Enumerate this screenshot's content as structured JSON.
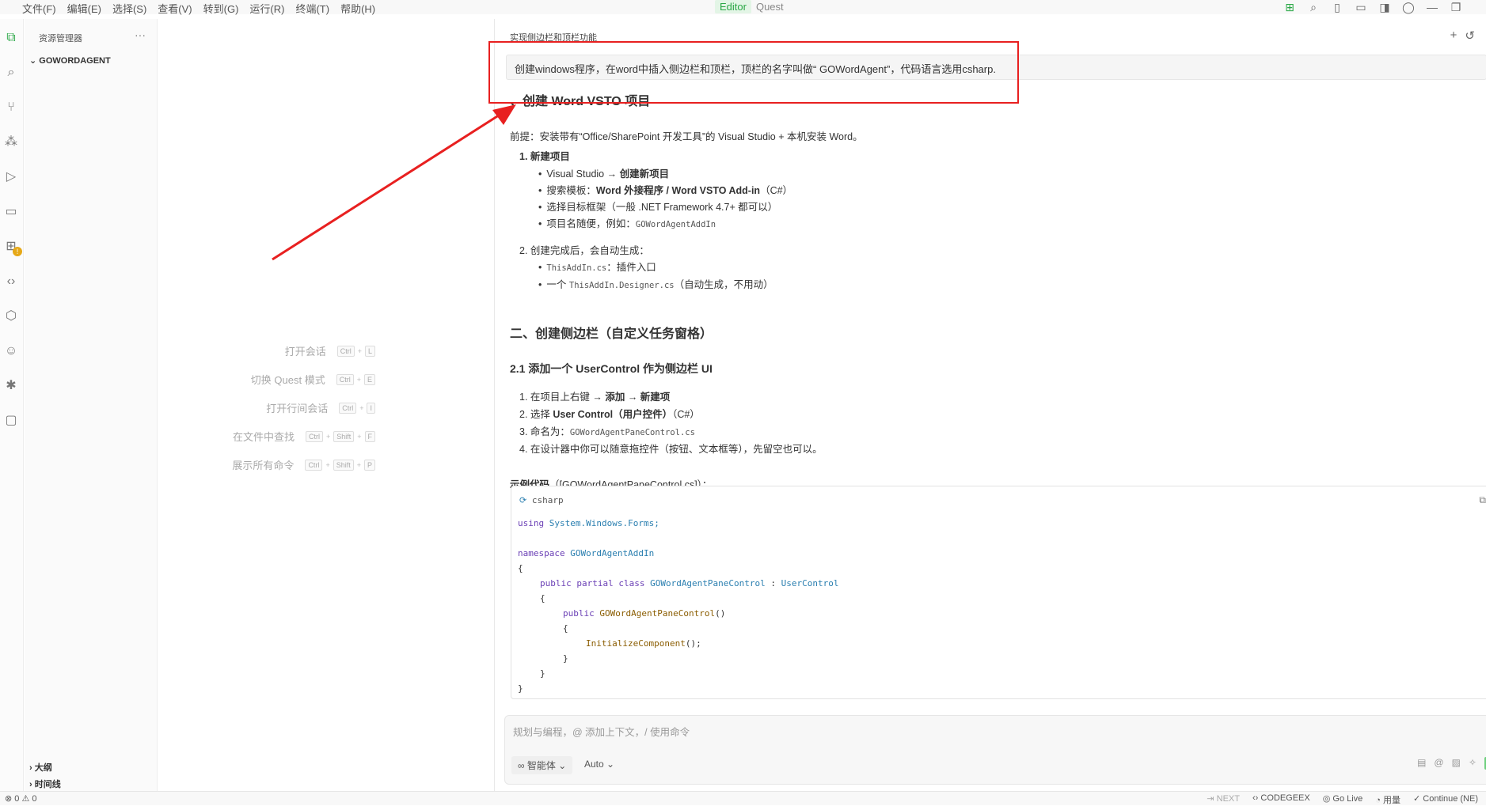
{
  "menubar": {
    "items": [
      "文件(F)",
      "编辑(E)",
      "选择(S)",
      "查看(V)",
      "转到(G)",
      "运行(R)",
      "终端(T)",
      "帮助(H)"
    ],
    "modes": {
      "editor": "Editor",
      "quest": "Quest"
    }
  },
  "explorer": {
    "title": "资源管理器",
    "more": "···",
    "root": "GOWORDAGENT",
    "outline": "大纲",
    "timeline": "时间线"
  },
  "welcome": {
    "shortcuts": [
      {
        "label": "打开会话",
        "keys": [
          "Ctrl",
          "L"
        ]
      },
      {
        "label": "切换 Quest 模式",
        "keys": [
          "Ctrl",
          "E"
        ]
      },
      {
        "label": "打开行间会话",
        "keys": [
          "Ctrl",
          "I"
        ]
      },
      {
        "label": "在文件中查找",
        "keys": [
          "Ctrl",
          "Shift",
          "F"
        ]
      },
      {
        "label": "展示所有命令",
        "keys": [
          "Ctrl",
          "Shift",
          "P"
        ]
      }
    ]
  },
  "chat": {
    "title": "实现侧边栏和顶栏功能",
    "user_message": "创建windows程序，在word中插入侧边栏和顶栏，顶栏的名字叫做“ GOWordAgent”，代码语言选用csharp.",
    "heading1": "、创建 Word VSTO 项目",
    "premise": "前提：安装带有“Office/SharePoint 开发工具”的 Visual Studio + 本机安装 Word。",
    "step1": "1. 新建项目",
    "step1_items": {
      "a_prefix": "Visual Studio → ",
      "a_bold": "创建新项目",
      "b_prefix": "搜索模板：",
      "b_bold": "Word 外接程序 / Word VSTO Add-in",
      "b_suffix": "（C#）",
      "c": "选择目标框架（一般 .NET Framework 4.7+ 都可以）",
      "d_prefix": "项目名随便，例如：",
      "d_code": "GOWordAgentAddIn"
    },
    "step2": "2. 创建完成后，会自动生成：",
    "step2_items": {
      "a_code": "ThisAddIn.cs",
      "a_suffix": "：插件入口",
      "b_prefix": "一个 ",
      "b_code": "ThisAddIn.Designer.cs",
      "b_suffix": "（自动生成，不用动）"
    },
    "heading2": "二、创建侧边栏（自定义任务窗格）",
    "heading3": "2.1 添加一个 UserControl 作为侧边栏 UI",
    "sub_items": {
      "one_prefix": "1. 在项目上右键 → ",
      "one_bold": "添加 → 新建项",
      "two_prefix": "2. 选择 ",
      "two_bold": "User Control（用户控件）",
      "two_suffix": "（C#）",
      "three_prefix": "3. 命名为：",
      "three_code": "GOWordAgentPaneControl.cs",
      "four": "4. 在设计器中你可以随意拖控件（按钮、文本框等），先留空也可以。"
    },
    "example_bold": "示例代码",
    "example_suffix": "（[GOWordAgentPaneControl.cs]）：",
    "code_lang": "csharp",
    "code": {
      "l1_kw": "using",
      "l1_ns": "System.Windows.Forms;",
      "l3_kw": "namespace",
      "l3_ns": "GOWordAgentAddIn",
      "l4": "{",
      "l5_kw": "public partial class",
      "l5_cls": "GOWordAgentPaneControl",
      "l5_sep": " : ",
      "l5_base": "UserControl",
      "l6": "{",
      "l7_kw": "public",
      "l7_fn": "GOWordAgentPaneControl",
      "l7_rest": "()",
      "l8": "{",
      "l9_fn": "InitializeComponent",
      "l9_rest": "();",
      "l10": "}",
      "l11": "}",
      "l12": "}"
    },
    "input_placeholder": "规划与编程，@ 添加上下文，/ 使用命令",
    "agent_label": "智能体",
    "auto_label": "Auto"
  },
  "status": {
    "problems": "⊗ 0 ⚠ 0",
    "next": "⇥ NEXT",
    "codegeex": "CODEGEEX",
    "golive": "Go Live",
    "usage": "用量",
    "continue": "Continue (NE)"
  }
}
